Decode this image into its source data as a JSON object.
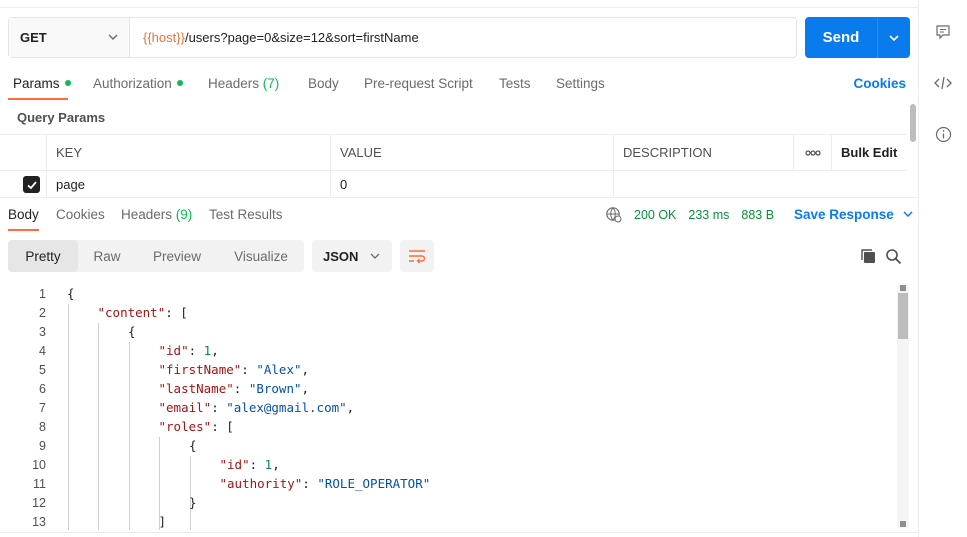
{
  "request": {
    "method": "GET",
    "url_variable": "{{host}}",
    "url_path": "/users?page=0&size=12&sort=firstName",
    "send_label": "Send"
  },
  "request_tabs": {
    "params": "Params",
    "authorization": "Authorization",
    "headers": "Headers",
    "headers_count": "(7)",
    "body": "Body",
    "pre_request_script": "Pre-request Script",
    "tests": "Tests",
    "settings": "Settings",
    "cookies": "Cookies"
  },
  "query_params": {
    "title": "Query Params",
    "columns": {
      "key": "KEY",
      "value": "VALUE",
      "description": "DESCRIPTION",
      "more": "ooo",
      "bulk_edit": "Bulk Edit"
    },
    "rows": [
      {
        "checked": true,
        "key": "page",
        "value": "0",
        "description": ""
      }
    ]
  },
  "response_tabs": {
    "body": "Body",
    "cookies": "Cookies",
    "headers": "Headers",
    "headers_count": "(9)",
    "test_results": "Test Results"
  },
  "response_status": {
    "status": "200 OK",
    "time": "233 ms",
    "size": "883 B",
    "save_response": "Save Response"
  },
  "view_modes": [
    "Pretty",
    "Raw",
    "Preview",
    "Visualize"
  ],
  "active_view_mode": "Pretty",
  "format": "JSON",
  "code_lines": [
    {
      "n": "1",
      "indent": 0,
      "parts": [
        [
          "pun",
          "{"
        ]
      ]
    },
    {
      "n": "2",
      "indent": 1,
      "parts": [
        [
          "key",
          "\"content\""
        ],
        [
          "pun",
          ": ["
        ]
      ]
    },
    {
      "n": "3",
      "indent": 2,
      "parts": [
        [
          "pun",
          "{"
        ]
      ]
    },
    {
      "n": "4",
      "indent": 3,
      "parts": [
        [
          "key",
          "\"id\""
        ],
        [
          "pun",
          ": "
        ],
        [
          "num",
          "1"
        ],
        [
          "pun",
          ","
        ]
      ]
    },
    {
      "n": "5",
      "indent": 3,
      "parts": [
        [
          "key",
          "\"firstName\""
        ],
        [
          "pun",
          ": "
        ],
        [
          "str",
          "\"Alex\""
        ],
        [
          "pun",
          ","
        ]
      ]
    },
    {
      "n": "6",
      "indent": 3,
      "parts": [
        [
          "key",
          "\"lastName\""
        ],
        [
          "pun",
          ": "
        ],
        [
          "str",
          "\"Brown\""
        ],
        [
          "pun",
          ","
        ]
      ]
    },
    {
      "n": "7",
      "indent": 3,
      "parts": [
        [
          "key",
          "\"email\""
        ],
        [
          "pun",
          ": "
        ],
        [
          "str",
          "\"alex@gmail.com\""
        ],
        [
          "pun",
          ","
        ]
      ]
    },
    {
      "n": "8",
      "indent": 3,
      "parts": [
        [
          "key",
          "\"roles\""
        ],
        [
          "pun",
          ": ["
        ]
      ]
    },
    {
      "n": "9",
      "indent": 4,
      "parts": [
        [
          "pun",
          "{"
        ]
      ]
    },
    {
      "n": "10",
      "indent": 5,
      "parts": [
        [
          "key",
          "\"id\""
        ],
        [
          "pun",
          ": "
        ],
        [
          "num",
          "1"
        ],
        [
          "pun",
          ","
        ]
      ]
    },
    {
      "n": "11",
      "indent": 5,
      "parts": [
        [
          "key",
          "\"authority\""
        ],
        [
          "pun",
          ": "
        ],
        [
          "str",
          "\"ROLE_OPERATOR\""
        ]
      ]
    },
    {
      "n": "12",
      "indent": 4,
      "parts": [
        [
          "pun",
          "}"
        ]
      ]
    },
    {
      "n": "13",
      "indent": 3,
      "parts": [
        [
          "pun",
          "]"
        ]
      ]
    }
  ],
  "colors": {
    "accent": "#097bed",
    "active_tab_underline": "#ff6c37",
    "status_green": "#0cbb52",
    "url_variable": "#e0753a"
  },
  "icons": {
    "sidebar": [
      "comments-icon",
      "code-icon",
      "info-icon"
    ]
  }
}
